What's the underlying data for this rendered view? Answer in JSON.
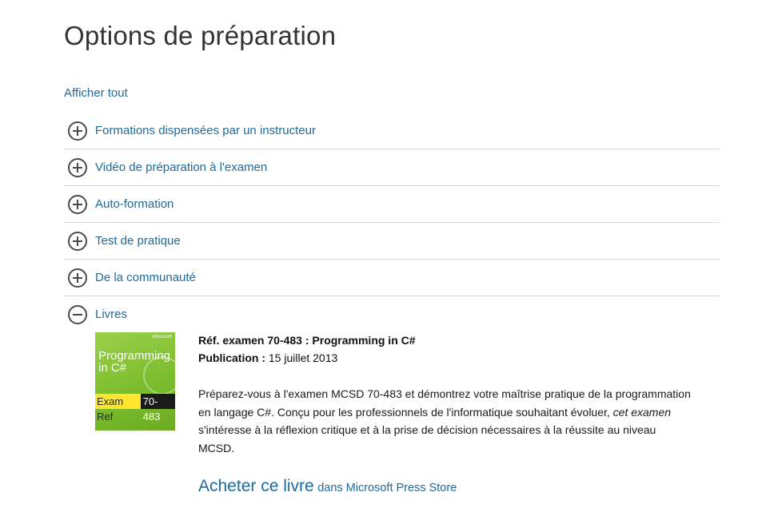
{
  "page": {
    "title": "Options de préparation",
    "show_all": "Afficher tout"
  },
  "accordion": {
    "items": [
      {
        "label": "Formations dispensées par un instructeur",
        "icon": "plus-circle-icon",
        "expanded": false
      },
      {
        "label": "Vidéo de préparation à l'examen",
        "icon": "plus-circle-icon",
        "expanded": false
      },
      {
        "label": "Auto-formation",
        "icon": "plus-circle-icon",
        "expanded": false
      },
      {
        "label": "Test de pratique",
        "icon": "plus-circle-icon",
        "expanded": false
      },
      {
        "label": "De la communauté",
        "icon": "plus-circle-icon",
        "expanded": false
      },
      {
        "label": "Livres",
        "icon": "minus-circle-icon",
        "expanded": true
      }
    ]
  },
  "book": {
    "cover": {
      "brand": "Microsoft",
      "title": "Programming in C#",
      "series": "Exam Ref",
      "exam_number": "70-483"
    },
    "reference": "Réf. examen 70-483 : Programming in C#",
    "publication_label": "Publication :",
    "publication_date": "15 juillet 2013",
    "description_part1": "Préparez-vous à l'examen MCSD 70-483 et démontrez votre maîtrise pratique de la programmation en langage C#. Conçu pour les professionnels de l'informatique souhaitant évoluer, ",
    "description_em": "cet examen",
    "description_part2": " s'intéresse à la réflexion critique et à la prise de décision nécessaires à la réussite au niveau MCSD.",
    "buy_link": "Acheter ce livre",
    "buy_suffix": "dans Microsoft Press Store"
  },
  "colors": {
    "link": "#1e6a9c",
    "cover_green": "#7cbd2e",
    "cover_yellow": "#ffe62e"
  }
}
